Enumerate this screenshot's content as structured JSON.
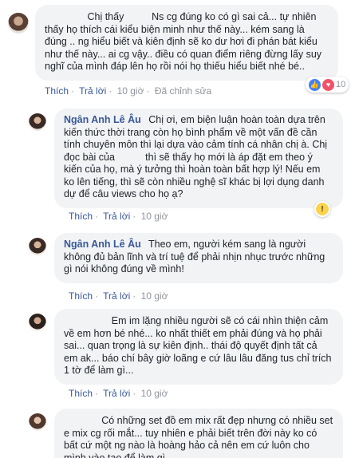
{
  "comments": [
    {
      "author": "",
      "text_parts": [
        "Chị thấy ",
        "",
        "Ns cg đúng ko có gì sai cả... tự nhiên thấy họ thích cái kiểu biện minh như thế này... kém sang là đúng .. ng hiểu biết và kiên định sẽ ko dư hơi đi phán bát kiểu như thế này... ai cg vậy.. điều có quan điểm riêng đừng lấy suy nghĩ của mình đáp lên họ rồi nói họ thiếu hiểu biết nhé bé.."
      ],
      "like_label": "Thích",
      "reply_label": "Trả lời",
      "time": "10 giờ",
      "edited": "Đã chỉnh sửa",
      "reaction_count": "10"
    },
    {
      "author": "Ngân Anh Lê Âu",
      "text_parts": [
        "Chị ơi, em biện luận hoàn toàn dựa trên kiến thức thời trang còn họ bình phẩm về một vấn đề cần tính chuyên môn thì lại dựa vào cảm tính cá nhân chị à. Chị đọc bài của ",
        "",
        " thì sẽ thấy họ mới là áp đặt em theo ý kiến của họ, mà ý tưởng thì hoàn toàn bất hợp lý! Nếu em ko lên tiếng, thì sẽ còn nhiều nghệ sĩ khác bị lợi dụng danh dự để câu views cho họ ạ?"
      ],
      "like_label": "Thích",
      "reply_label": "Trả lời",
      "time": "10 giờ"
    },
    {
      "author": "Ngân Anh Lê Âu",
      "text_parts": [
        "Theo em, người kém sang là người không đủ bản lĩnh và trí tuệ để phải nhịn nhục trước những gì nói không đúng về mình!"
      ],
      "like_label": "Thích",
      "reply_label": "Trả lời",
      "time": "10 giờ"
    },
    {
      "author": "",
      "text_parts": [
        "Em im lặng nhiều người sẽ có cái nhìn thiện cảm về em hơn bé nhé... ko nhất thiết em phải đúng và họ phải sai... quan trọng là sự kiên định.. thái độ quyết định tất cả em ak... báo chí bây giờ loãng e cứ lâu lâu đăng tus chỉ trích 1 tờ để làm gì..."
      ],
      "like_label": "Thích",
      "reply_label": "Trả lời",
      "time": "10 giờ"
    },
    {
      "author": "",
      "text_parts": [
        "Có những set đồ em mix rất đẹp nhưng có nhiều set e mix cg rối mắt... tuy nhiên e phải biết trên đời này ko có bất cứ một ng nào là hoàng hảo cả nên em cứ luôn cho mình vào tạo để làm gì..."
      ]
    }
  ],
  "colors": {
    "link": "#385898",
    "bubble": "#f2f3f5",
    "like": "#4080ff",
    "heart": "#f25268"
  }
}
